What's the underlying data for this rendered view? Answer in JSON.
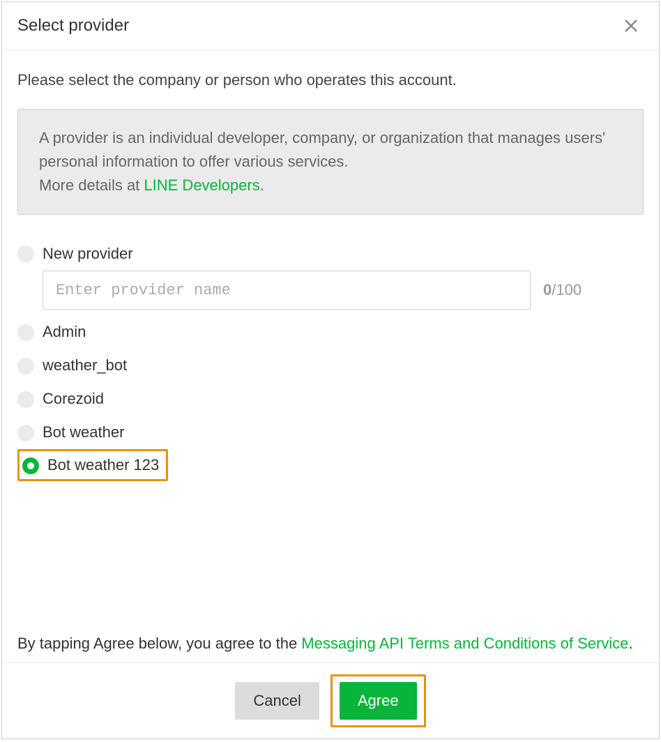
{
  "modal": {
    "title": "Select provider",
    "instruction": "Please select the company or person who operates this account.",
    "info": {
      "text": "A provider is an individual developer, company, or organization that manages users' personal information to offer various services.",
      "more_prefix": "More details at ",
      "link_label": "LINE Developers",
      "suffix": "."
    },
    "providers": {
      "new_label": "New provider",
      "input_placeholder": "Enter provider name",
      "input_value": "",
      "char_current": "0",
      "char_sep": "/",
      "char_max": "100",
      "items": [
        {
          "label": "Admin",
          "selected": false
        },
        {
          "label": "weather_bot",
          "selected": false
        },
        {
          "label": "Corezoid",
          "selected": false
        },
        {
          "label": "Bot weather",
          "selected": false
        },
        {
          "label": "Bot weather 123",
          "selected": true
        }
      ]
    },
    "agree": {
      "prefix": "By tapping Agree below, you agree to the ",
      "link": "Messaging API Terms and Conditions of Service",
      "suffix": "."
    },
    "buttons": {
      "cancel": "Cancel",
      "agree": "Agree"
    }
  }
}
